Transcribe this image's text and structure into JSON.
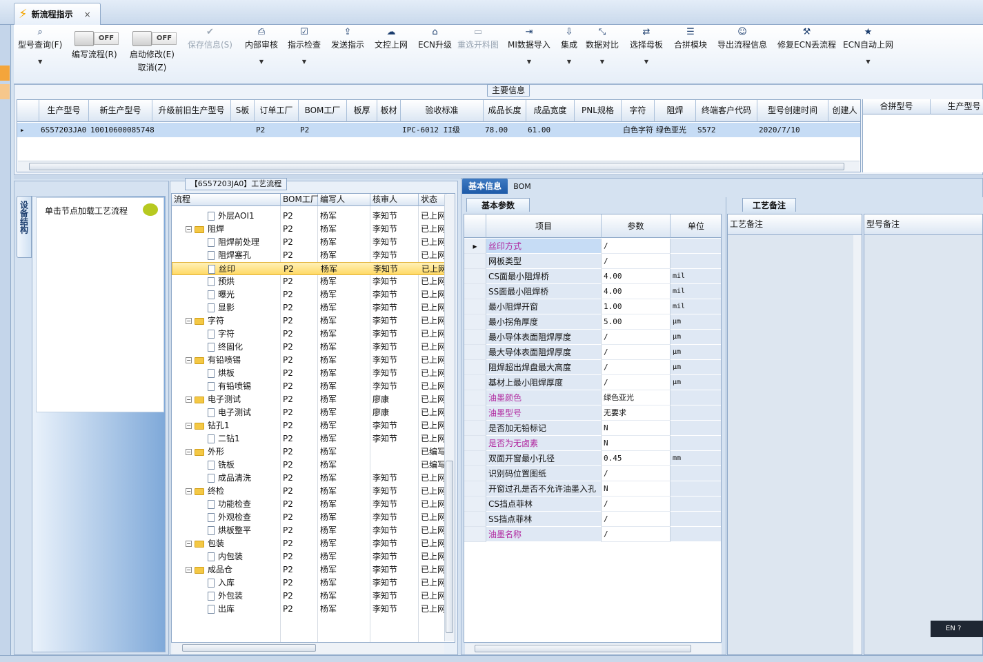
{
  "window": {
    "tab_title": "新流程指示",
    "tab_close": "×"
  },
  "toolbar": {
    "items": [
      {
        "label": "型号查询(F)",
        "icon": "search-icon"
      },
      {
        "label": "编写流程(R)",
        "toggle": "OFF"
      },
      {
        "label": "启动修改(E)",
        "sub": "取消(Z)",
        "toggle": "OFF"
      },
      {
        "label": "保存信息(S)",
        "icon": "save-icon",
        "disabled": true
      },
      {
        "label": "内部审核",
        "icon": "print-icon"
      },
      {
        "label": "指示检查",
        "icon": "check-icon"
      },
      {
        "label": "发送指示",
        "icon": "send-icon"
      },
      {
        "label": "文控上网",
        "icon": "cloud-upload-icon"
      },
      {
        "label": "ECN升级",
        "icon": "ecn-icon"
      },
      {
        "label": "重选开料图",
        "icon": "image-icon",
        "disabled": true
      },
      {
        "label": "MI数据导入",
        "icon": "import-icon"
      },
      {
        "label": "集成",
        "icon": "download-icon"
      },
      {
        "label": "数据对比",
        "icon": "compare-icon"
      },
      {
        "label": "选择母板",
        "icon": "shuffle-icon"
      },
      {
        "label": "合拼模块",
        "icon": "list-icon"
      },
      {
        "label": "导出流程信息",
        "icon": "smile-icon"
      },
      {
        "label": "修复ECN丢流程",
        "icon": "wrench-icon"
      },
      {
        "label": "ECN自动上网",
        "icon": "star-icon"
      }
    ]
  },
  "main_info": {
    "title": "主要信息",
    "columns": [
      "生产型号",
      "新生产型号",
      "升级前旧生产型号",
      "S板",
      "订单工厂",
      "BOM工厂",
      "板厚",
      "板材",
      "验收标准",
      "成品长度",
      "成品宽度",
      "PNL规格",
      "字符",
      "阻焊",
      "终端客户代码",
      "型号创建时间",
      "创建人"
    ],
    "row": [
      "6S57203JA0",
      "10010600085748",
      "",
      "",
      "P2",
      "P2",
      "",
      "",
      "IPC-6012 II级",
      "78.00",
      "61.00",
      "",
      "白色字符",
      "绿色亚光",
      "S572",
      "2020/7/10",
      ""
    ],
    "side_columns": [
      "合拼型号",
      "生产型号"
    ]
  },
  "device": {
    "tab_label": "设备结构",
    "hint": "单击节点加载工艺流程"
  },
  "process": {
    "title": "【6S57203JA0】工艺流程",
    "columns": [
      "流程",
      "BOM工厂",
      "编写人",
      "核审人",
      "状态"
    ],
    "rows": [
      {
        "level": 2,
        "name": "外层AOI1",
        "bom": "P2",
        "writer": "杨军",
        "reviewer": "李知节",
        "status": "已上网"
      },
      {
        "level": 1,
        "name": "阻焊",
        "bom": "P2",
        "writer": "杨军",
        "reviewer": "李知节",
        "status": "已上网"
      },
      {
        "level": 2,
        "name": "阻焊前处理",
        "bom": "P2",
        "writer": "杨军",
        "reviewer": "李知节",
        "status": "已上网"
      },
      {
        "level": 2,
        "name": "阻焊塞孔",
        "bom": "P2",
        "writer": "杨军",
        "reviewer": "李知节",
        "status": "已上网"
      },
      {
        "level": 2,
        "name": "丝印",
        "bom": "P2",
        "writer": "杨军",
        "reviewer": "李知节",
        "status": "已上网",
        "selected": true
      },
      {
        "level": 2,
        "name": "预烘",
        "bom": "P2",
        "writer": "杨军",
        "reviewer": "李知节",
        "status": "已上网"
      },
      {
        "level": 2,
        "name": "曝光",
        "bom": "P2",
        "writer": "杨军",
        "reviewer": "李知节",
        "status": "已上网"
      },
      {
        "level": 2,
        "name": "显影",
        "bom": "P2",
        "writer": "杨军",
        "reviewer": "李知节",
        "status": "已上网"
      },
      {
        "level": 1,
        "name": "字符",
        "bom": "P2",
        "writer": "杨军",
        "reviewer": "李知节",
        "status": "已上网"
      },
      {
        "level": 2,
        "name": "字符",
        "bom": "P2",
        "writer": "杨军",
        "reviewer": "李知节",
        "status": "已上网"
      },
      {
        "level": 2,
        "name": "终固化",
        "bom": "P2",
        "writer": "杨军",
        "reviewer": "李知节",
        "status": "已上网"
      },
      {
        "level": 1,
        "name": "有铅喷锡",
        "bom": "P2",
        "writer": "杨军",
        "reviewer": "李知节",
        "status": "已上网"
      },
      {
        "level": 2,
        "name": "烘板",
        "bom": "P2",
        "writer": "杨军",
        "reviewer": "李知节",
        "status": "已上网"
      },
      {
        "level": 2,
        "name": "有铅喷锡",
        "bom": "P2",
        "writer": "杨军",
        "reviewer": "李知节",
        "status": "已上网"
      },
      {
        "level": 1,
        "name": "电子测试",
        "bom": "P2",
        "writer": "杨军",
        "reviewer": "廖康",
        "status": "已上网"
      },
      {
        "level": 2,
        "name": "电子测试",
        "bom": "P2",
        "writer": "杨军",
        "reviewer": "廖康",
        "status": "已上网"
      },
      {
        "level": 1,
        "name": "钻孔1",
        "bom": "P2",
        "writer": "杨军",
        "reviewer": "李知节",
        "status": "已上网"
      },
      {
        "level": 2,
        "name": "二钻1",
        "bom": "P2",
        "writer": "杨军",
        "reviewer": "李知节",
        "status": "已上网"
      },
      {
        "level": 1,
        "name": "外形",
        "bom": "P2",
        "writer": "杨军",
        "reviewer": "",
        "status": "已编写"
      },
      {
        "level": 2,
        "name": "铣板",
        "bom": "P2",
        "writer": "杨军",
        "reviewer": "",
        "status": "已编写"
      },
      {
        "level": 2,
        "name": "成品清洗",
        "bom": "P2",
        "writer": "杨军",
        "reviewer": "李知节",
        "status": "已上网"
      },
      {
        "level": 1,
        "name": "终检",
        "bom": "P2",
        "writer": "杨军",
        "reviewer": "李知节",
        "status": "已上网"
      },
      {
        "level": 2,
        "name": "功能检查",
        "bom": "P2",
        "writer": "杨军",
        "reviewer": "李知节",
        "status": "已上网"
      },
      {
        "level": 2,
        "name": "外观检查",
        "bom": "P2",
        "writer": "杨军",
        "reviewer": "李知节",
        "status": "已上网"
      },
      {
        "level": 2,
        "name": "烘板整平",
        "bom": "P2",
        "writer": "杨军",
        "reviewer": "李知节",
        "status": "已上网"
      },
      {
        "level": 1,
        "name": "包装",
        "bom": "P2",
        "writer": "杨军",
        "reviewer": "李知节",
        "status": "已上网"
      },
      {
        "level": 2,
        "name": "内包装",
        "bom": "P2",
        "writer": "杨军",
        "reviewer": "李知节",
        "status": "已上网"
      },
      {
        "level": 1,
        "name": "成品仓",
        "bom": "P2",
        "writer": "杨军",
        "reviewer": "李知节",
        "status": "已上网"
      },
      {
        "level": 2,
        "name": "入库",
        "bom": "P2",
        "writer": "杨军",
        "reviewer": "李知节",
        "status": "已上网"
      },
      {
        "level": 2,
        "name": "外包装",
        "bom": "P2",
        "writer": "杨军",
        "reviewer": "李知节",
        "status": "已上网"
      },
      {
        "level": 2,
        "name": "出库",
        "bom": "P2",
        "writer": "杨军",
        "reviewer": "李知节",
        "status": "已上网"
      }
    ]
  },
  "detail_tabs": {
    "basic": "基本信息",
    "bom": "BOM"
  },
  "params": {
    "tab": "基本参数",
    "columns": [
      "项目",
      "参数",
      "单位"
    ],
    "rows": [
      {
        "item": "丝印方式",
        "value": "/",
        "unit": "",
        "highlight": true,
        "selected": true
      },
      {
        "item": "网板类型",
        "value": "/",
        "unit": ""
      },
      {
        "item": "CS面最小阻焊桥",
        "value": "4.00",
        "unit": "mil"
      },
      {
        "item": "SS面最小阻焊桥",
        "value": "4.00",
        "unit": "mil"
      },
      {
        "item": "最小阻焊开窗",
        "value": "1.00",
        "unit": "mil"
      },
      {
        "item": "最小拐角厚度",
        "value": "5.00",
        "unit": "μm"
      },
      {
        "item": "最小导体表面阻焊厚度",
        "value": "/",
        "unit": "μm"
      },
      {
        "item": "最大导体表面阻焊厚度",
        "value": "/",
        "unit": "μm"
      },
      {
        "item": "阻焊超出焊盘最大高度",
        "value": "/",
        "unit": "μm"
      },
      {
        "item": "基材上最小阻焊厚度",
        "value": "/",
        "unit": "μm"
      },
      {
        "item": "油墨颜色",
        "value": "绿色亚光",
        "unit": "",
        "highlight": true
      },
      {
        "item": "油墨型号",
        "value": "无要求",
        "unit": "",
        "highlight": true
      },
      {
        "item": "是否加无铅标记",
        "value": "N",
        "unit": ""
      },
      {
        "item": "是否为无卤素",
        "value": "N",
        "unit": "",
        "highlight": true
      },
      {
        "item": "双面开窗最小孔径",
        "value": "0.45",
        "unit": "mm"
      },
      {
        "item": "识别码位置图纸",
        "value": "/",
        "unit": ""
      },
      {
        "item": "开窗过孔是否不允许油墨入孔",
        "value": "N",
        "unit": ""
      },
      {
        "item": "CS挡点菲林",
        "value": "/",
        "unit": ""
      },
      {
        "item": "SS挡点菲林",
        "value": "/",
        "unit": ""
      },
      {
        "item": "油墨名称",
        "value": "/",
        "unit": "",
        "highlight": true
      }
    ]
  },
  "notes": {
    "tab": "工艺备注",
    "col1": "工艺备注",
    "col2": "型号备注"
  },
  "ime": {
    "label": "EN"
  }
}
